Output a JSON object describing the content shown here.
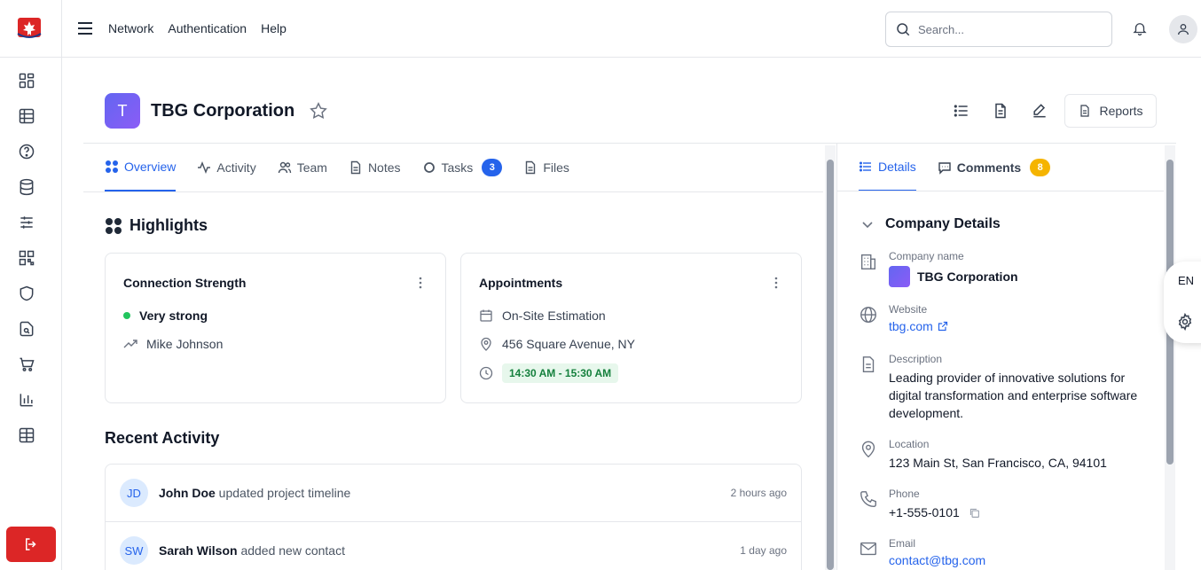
{
  "topnav": {
    "network": "Network",
    "authentication": "Authentication",
    "help": "Help"
  },
  "search": {
    "placeholder": "Search..."
  },
  "company": {
    "initial": "T",
    "name": "TBG Corporation"
  },
  "actions": {
    "reports": "Reports"
  },
  "tabs": {
    "overview": "Overview",
    "activity": "Activity",
    "team": "Team",
    "notes": "Notes",
    "tasks": "Tasks",
    "tasks_count": "3",
    "files": "Files"
  },
  "highlights": {
    "title": "Highlights",
    "connection": {
      "title": "Connection Strength",
      "status": "Very strong",
      "person": "Mike Johnson"
    },
    "appointments": {
      "title": "Appointments",
      "event": "On-Site Estimation",
      "address": "456 Square Avenue, NY",
      "time": "14:30 AM - 15:30 AM"
    }
  },
  "recent": {
    "title": "Recent Activity",
    "items": [
      {
        "initials": "JD",
        "name": "John Doe",
        "action": "updated project timeline",
        "time": "2 hours ago"
      },
      {
        "initials": "SW",
        "name": "Sarah Wilson",
        "action": "added new contact",
        "time": "1 day ago"
      }
    ]
  },
  "right": {
    "tabs": {
      "details": "Details",
      "comments": "Comments",
      "comments_count": "8"
    },
    "section_title": "Company Details",
    "fields": {
      "company_label": "Company name",
      "company_value": "TBG Corporation",
      "website_label": "Website",
      "website_value": "tbg.com",
      "description_label": "Description",
      "description_value": "Leading provider of innovative solutions for digital transformation and enterprise software development.",
      "location_label": "Location",
      "location_value": "123 Main St, San Francisco, CA, 94101",
      "phone_label": "Phone",
      "phone_value": "+1-555-0101",
      "email_label": "Email",
      "email_value": "contact@tbg.com"
    }
  },
  "widget": {
    "language": "EN"
  },
  "colors": {
    "accent": "#2563eb",
    "danger": "#dc2626",
    "success": "#22c55e",
    "warning": "#f5b400"
  }
}
